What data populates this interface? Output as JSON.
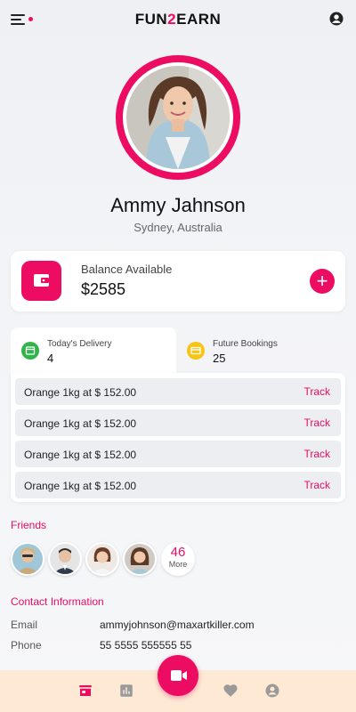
{
  "header": {
    "brand_prefix": "FUN",
    "brand_two": "2",
    "brand_suffix": "EARN"
  },
  "profile": {
    "name": "Ammy Jahnson",
    "location": "Sydney, Australia"
  },
  "balance": {
    "label": "Balance Available",
    "value": "$2585",
    "add_label": "+"
  },
  "tabs": [
    {
      "title": "Today's Delivery",
      "count": "4",
      "icon": "calendar-icon"
    },
    {
      "title": "Future Bookings",
      "count": "25",
      "icon": "card-icon"
    }
  ],
  "orders": [
    {
      "text": "Orange 1kg at $ 152.00",
      "action": "Track"
    },
    {
      "text": "Orange 1kg at $ 152.00",
      "action": "Track"
    },
    {
      "text": "Orange 1kg at $ 152.00",
      "action": "Track"
    },
    {
      "text": "Orange 1kg at $ 152.00",
      "action": "Track"
    }
  ],
  "friends": {
    "title": "Friends",
    "more_count": "46",
    "more_label": "More"
  },
  "contact": {
    "title": "Contact Information",
    "email_label": "Email",
    "email": "ammyjohnson@maxartkiller.com",
    "phone_label": "Phone",
    "phone": "55 5555 555555 55"
  },
  "bottom_nav": [
    "store-icon",
    "stats-icon",
    "video-icon",
    "heart-icon",
    "account-icon"
  ],
  "colors": {
    "accent": "#ec0c62",
    "nav_bg": "#fde9d4",
    "tab_green": "#2fb34a",
    "tab_yellow": "#f5c518"
  }
}
